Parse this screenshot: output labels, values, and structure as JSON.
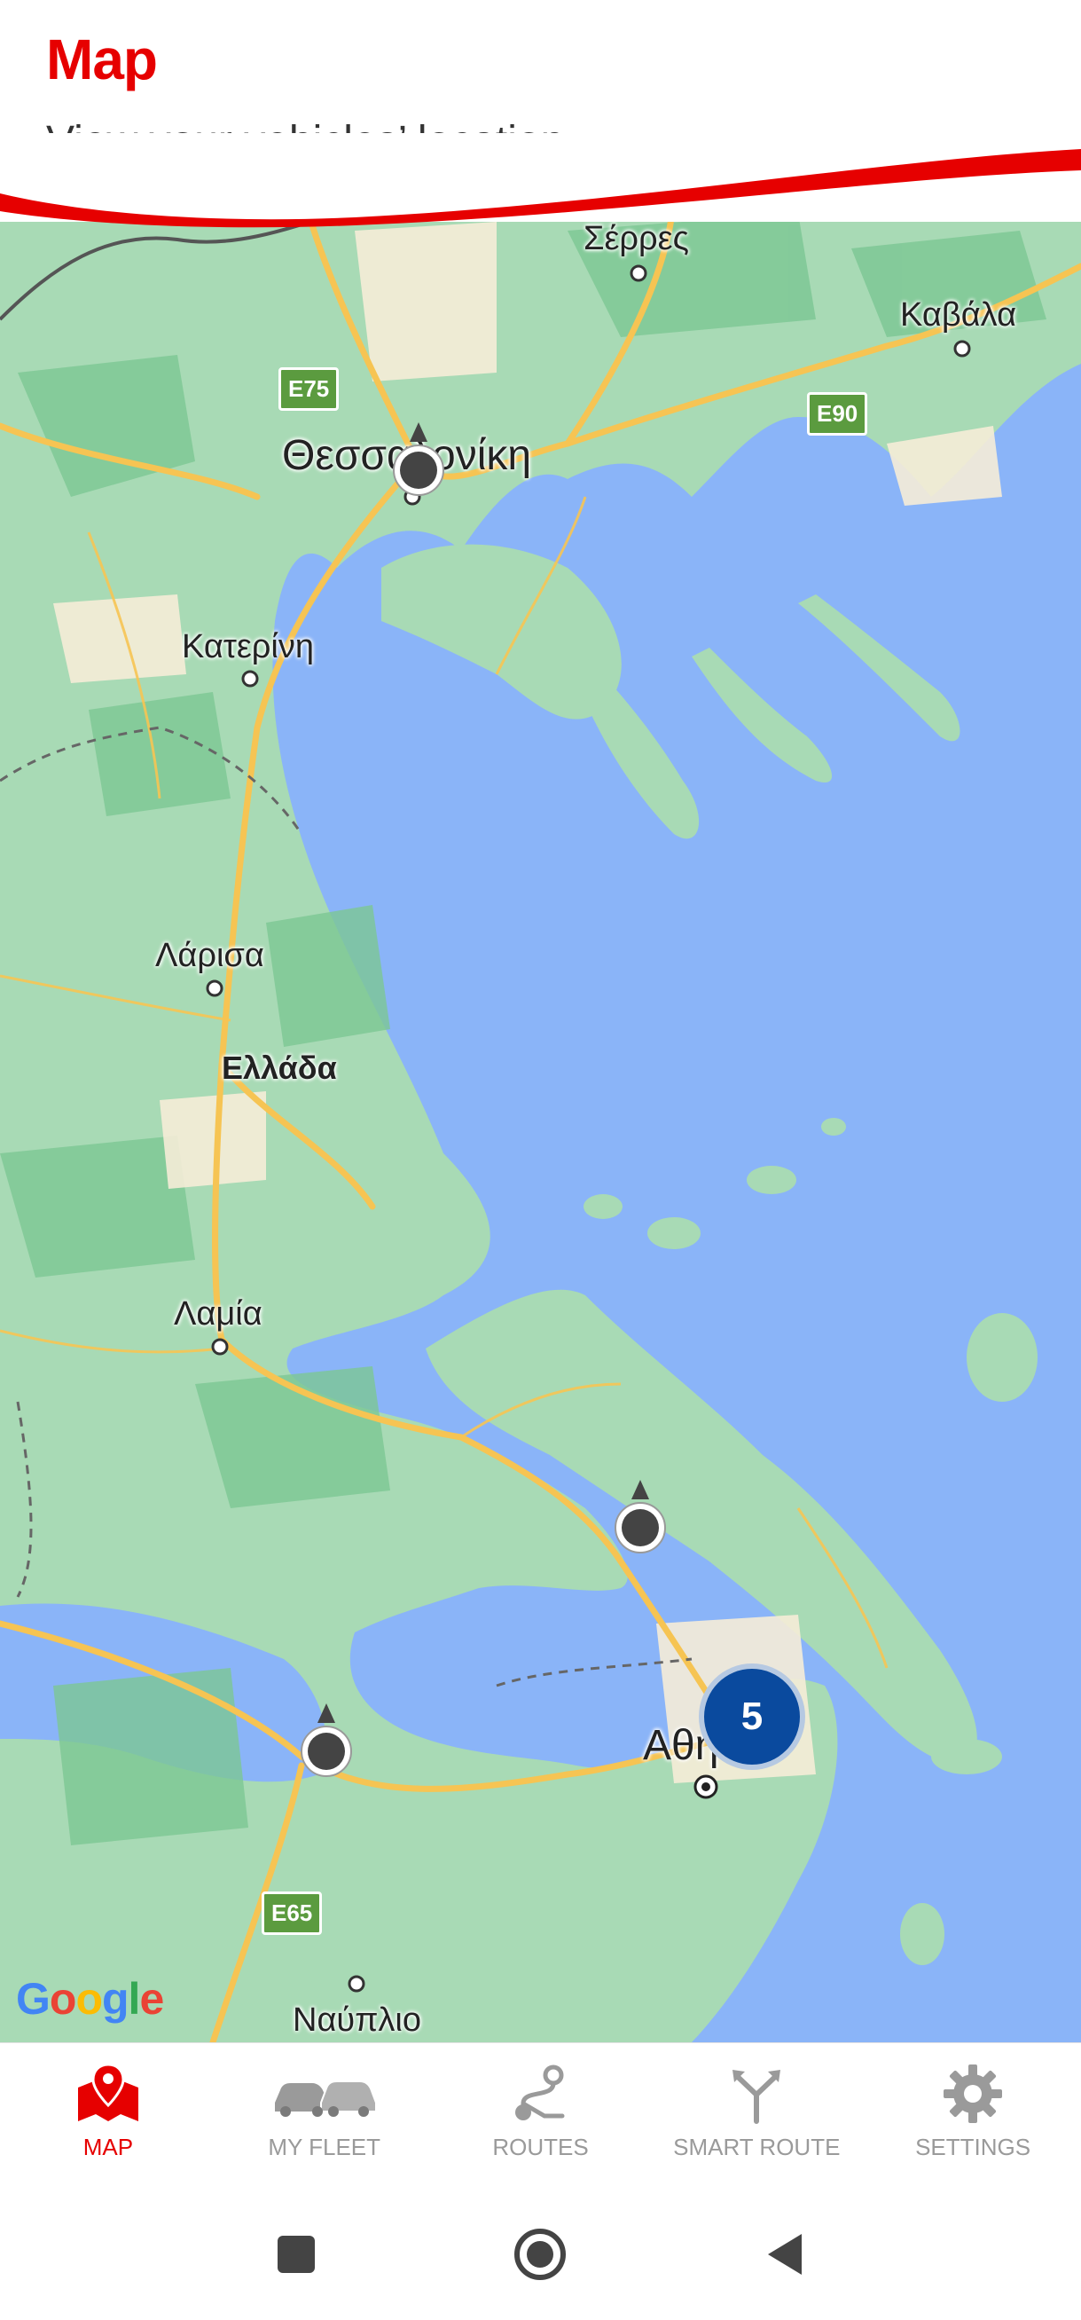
{
  "header": {
    "title": "Map",
    "subtitle": "View your vehicles’ location"
  },
  "colors": {
    "brand": "#e60000",
    "sea": "#8ab4f8",
    "land": "#a8dab5",
    "cluster": "#0a4a9e"
  },
  "map": {
    "cities": {
      "serres": "Σέρρες",
      "kavala": "Καβάλα",
      "thessaloniki": "Θεσσαλονίκη",
      "katerini": "Κατερίνη",
      "larisa": "Λάρισα",
      "ellada": "Ελλάδα",
      "lamia": "Λαμία",
      "athina": "Αθήνα",
      "nafplio": "Ναύπλιο"
    },
    "shields": {
      "e75": "E75",
      "e90": "E90",
      "e65": "E65"
    },
    "cluster_count": "5",
    "attribution": "Google"
  },
  "nav": {
    "items": [
      {
        "label": "MAP",
        "icon": "map-pin-icon",
        "active": true
      },
      {
        "label": "MY FLEET",
        "icon": "cars-icon",
        "active": false
      },
      {
        "label": "ROUTES",
        "icon": "route-icon",
        "active": false
      },
      {
        "label": "SMART ROUTE",
        "icon": "fork-arrow-icon",
        "active": false
      },
      {
        "label": "SETTINGS",
        "icon": "gear-icon",
        "active": false
      }
    ]
  },
  "system_nav": {
    "buttons": [
      "recents-button",
      "home-button",
      "back-button"
    ]
  }
}
